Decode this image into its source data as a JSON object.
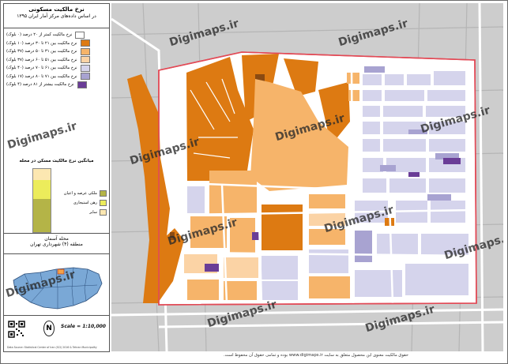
{
  "title": "نرخ مالکیت مسکونی",
  "subtitle": "در اساس داده‌های مرکز آمار ایران ۱۳۹۵",
  "legend": [
    {
      "label": "نرخ مالکیت کمتر از ۲۰ درصد (۰ بلوک)",
      "color": "#ffffff"
    },
    {
      "label": "نرخ مالکیت بین ۲۱ تا ۳۰ درصد (۱۰ بلوک)",
      "color": "#dd7a12"
    },
    {
      "label": "نرخ مالکیت بین ۳۱ تا ۵۰ درصد (۳۷ بلوک)",
      "color": "#f6b46a"
    },
    {
      "label": "نرخ مالکیت بین ۵۱ تا ۶۰ درصد (۳۷ بلوک)",
      "color": "#fbd3a5"
    },
    {
      "label": "نرخ مالکیت بین ۶۱ تا ۷۰ درصد (۴۰ بلوک)",
      "color": "#d5d4ec"
    },
    {
      "label": "نرخ مالکیت بین ۷۱ تا ۸۰ درصد (۱۷ بلوک)",
      "color": "#a8a3d1"
    },
    {
      "label": "نرخ مالکیت بیشتر از ۸۱ درصد (۴ بلوک)",
      "color": "#6a3d97"
    }
  ],
  "bar_chart": {
    "title": "میانگین نرخ مالکیت مسکن در محله",
    "segments": [
      {
        "label": "ملکی عرصه و اعیان",
        "color": "#b4b447",
        "fraction": 0.53
      },
      {
        "label": "رهن استیجاری",
        "color": "#ecec5b",
        "fraction": 0.3
      },
      {
        "label": "سایر",
        "color": "#fce7b1",
        "fraction": 0.17
      }
    ]
  },
  "location": {
    "line1": "محله آسمان",
    "line2": "منطقه (۴) شهرداری تهران"
  },
  "scale": "Scale = 1:10,000",
  "north": "N",
  "footer_note": "Data Source: Statistical Center of Iran (SCI) 2016 & Tehran Municipality",
  "watermark": "Digimaps.ir",
  "copyright": "حقوق مالکیت معنوی این محصول متعلق به سایت www.digimaps.ir بوده و تمامی حقوق آن محفوظ است.",
  "colors": {
    "boundary": "#e24a56",
    "street": "#ffffff",
    "background": "#cdcdcd",
    "inset_highlight": "#f3a24a"
  }
}
